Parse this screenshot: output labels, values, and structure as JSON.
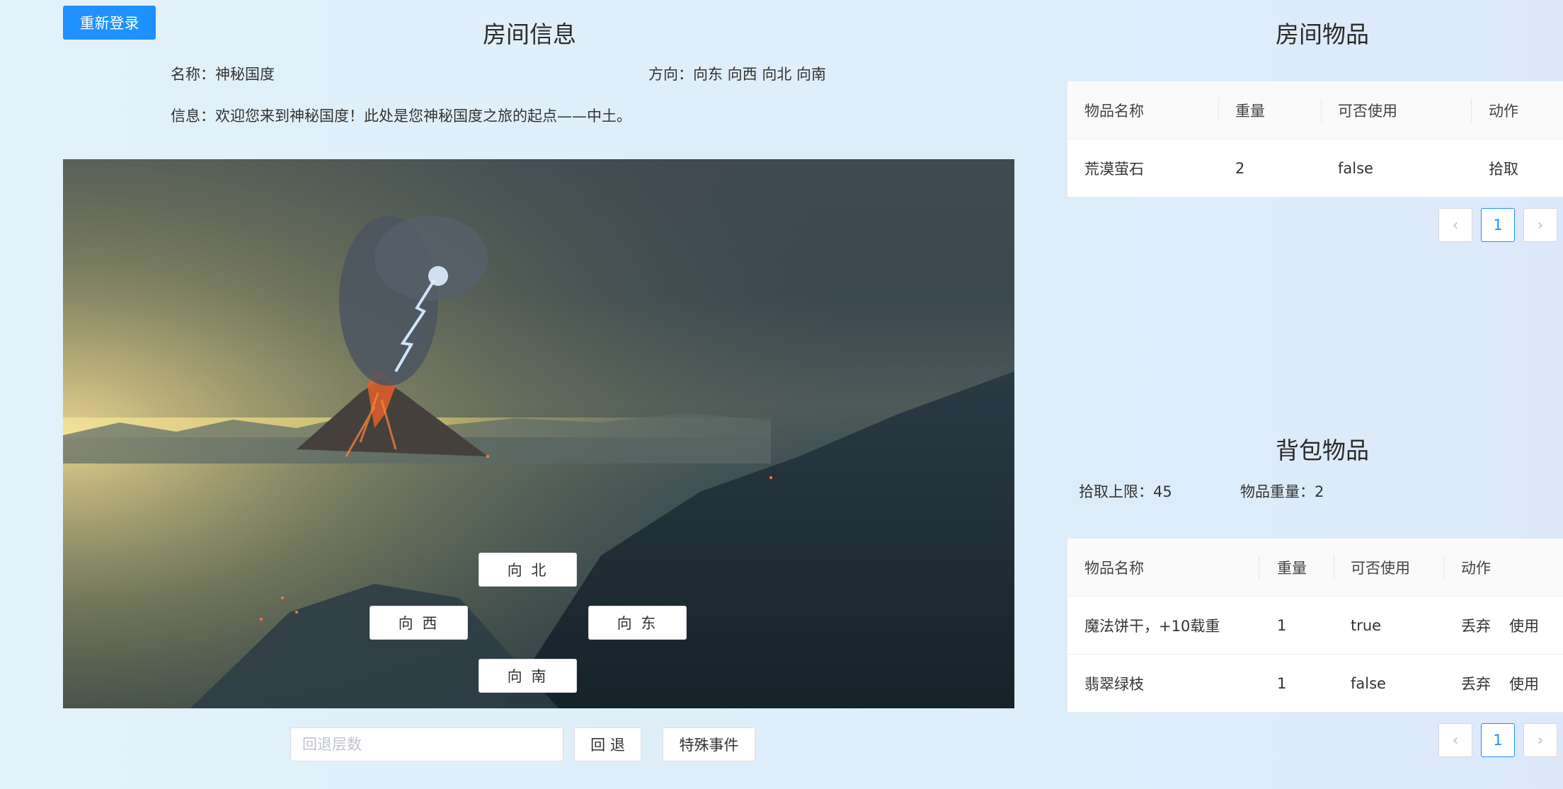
{
  "header": {
    "relogin_label": "重新登录"
  },
  "room_info": {
    "title": "房间信息",
    "name_text": "名称：神秘国度",
    "direction_text": "方向：向东 向西 向北 向南",
    "message_text": "信息：欢迎您来到神秘国度！此处是您神秘国度之旅的起点——中土。"
  },
  "scene": {
    "directions": {
      "north": "向 北",
      "west": "向 西",
      "east": "向 东",
      "south": "向 南"
    }
  },
  "controls": {
    "back_placeholder": "回退层数",
    "back_label": "回 退",
    "special_label": "特殊事件"
  },
  "room_items": {
    "title": "房间物品",
    "columns": [
      "物品名称",
      "重量",
      "可否使用",
      "动作"
    ],
    "rows": [
      {
        "name": "荒漠萤石",
        "weight": "2",
        "usable": "false",
        "action": "拾取"
      }
    ],
    "pager": {
      "prev_icon": "‹",
      "page": "1",
      "next_icon": "›"
    }
  },
  "backpack": {
    "title": "背包物品",
    "limit_text": "拾取上限：45",
    "weight_text": "物品重量：2",
    "columns": [
      "物品名称",
      "重量",
      "可否使用",
      "动作"
    ],
    "rows": [
      {
        "name": "魔法饼干，+10载重",
        "weight": "1",
        "usable": "true",
        "drop": "丢弃",
        "use": "使用"
      },
      {
        "name": "翡翠绿枝",
        "weight": "1",
        "usable": "false",
        "drop": "丢弃",
        "use": "使用"
      }
    ],
    "pager": {
      "prev_icon": "‹",
      "page": "1",
      "next_icon": "›"
    }
  },
  "colors": {
    "primary": "#1e90ff",
    "background": "#e2f2fa"
  }
}
